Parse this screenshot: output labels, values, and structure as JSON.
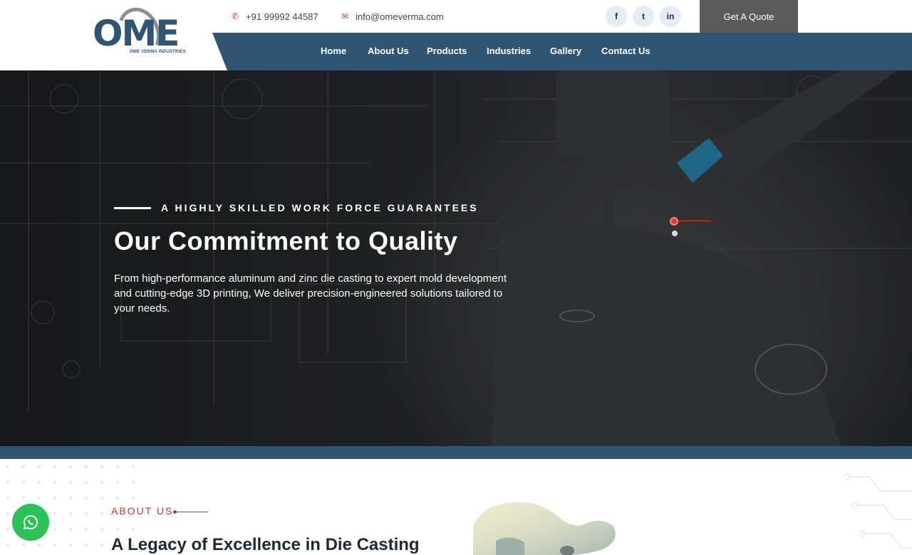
{
  "header": {
    "logo_text": "OME",
    "logo_subtext": "OME VERMA INDUSTRIES",
    "phone": "+91 99992 44587",
    "email": "info@omeverma.com",
    "social": [
      {
        "label": "f",
        "icon": "facebook-icon"
      },
      {
        "label": "t",
        "icon": "twitter-icon"
      },
      {
        "label": "in",
        "icon": "linkedin-icon"
      }
    ],
    "quote_button": "Get A Quote"
  },
  "nav": {
    "items": [
      "Home",
      "About Us",
      "Products",
      "Industries",
      "Gallery",
      "Contact Us"
    ]
  },
  "hero": {
    "eyebrow": "A HIGHLY SKILLED WORK FORCE GUARANTEES",
    "title": "Our Commitment to Quality",
    "description": "From high-performance aluminum and zinc die casting to expert mold development and cutting-edge 3D printing, We deliver precision-engineered solutions tailored to your needs.",
    "slide_count": 2,
    "active_slide": 1
  },
  "about": {
    "label": "ABOUT US",
    "title": "A Legacy of Excellence in Die Casting"
  },
  "colors": {
    "brand": "#2f5573",
    "accent": "#e03c2f",
    "quote_button": "#5a5a5a",
    "whatsapp": "#2bc256"
  }
}
